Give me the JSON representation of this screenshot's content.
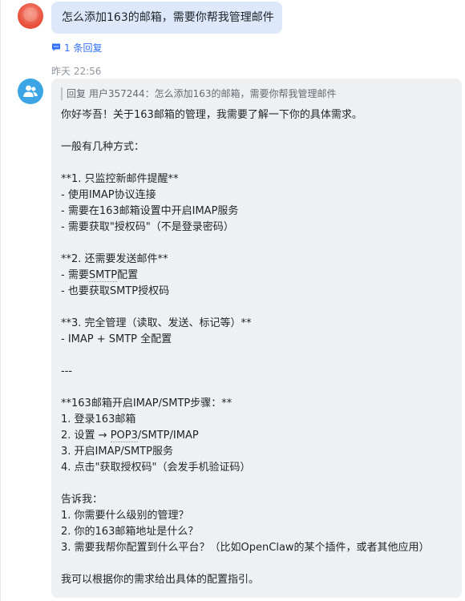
{
  "user_message": {
    "text": "怎么添加163的邮箱，需要你帮我管理邮件"
  },
  "reply_link": {
    "label": "1 条回复"
  },
  "timestamp": "昨天 22:56",
  "bot_message": {
    "quote": "回复 用户357244：怎么添加163的邮箱，需要你帮我管理邮件",
    "lines": [
      "你好岑吾！关于163邮箱的管理，我需要了解一下你的具体需求。",
      "",
      "一般有几种方式：",
      "",
      "**1. 只监控新邮件提醒**",
      "- 使用IMAP协议连接",
      "- 需要在163邮箱设置中开启IMAP服务",
      "- 需要获取\"授权码\"（不是登录密码）",
      "",
      "**2. 还需要发送邮件**",
      "- 需要SMTP配置",
      "- 也要获取SMTP授权码",
      "",
      "**3. 完全管理（读取、发送、标记等）**",
      "- IMAP + SMTP 全配置",
      "",
      "---",
      "",
      "**163邮箱开启IMAP/SMTP步骤：**",
      "1. 登录163邮箱",
      "2. 设置 → POP3/SMTP/IMAP",
      "3. 开启IMAP/SMTP服务",
      "4. 点击\"获取授权码\"（会发手机验证码）",
      "",
      "告诉我：",
      "1. 你需要什么级别的管理？",
      "2. 你的163邮箱地址是什么？",
      "3. 需要我帮你配置到什么平台？（比如OpenClaw的某个插件，或者其他应用）",
      "",
      "我可以根据你的需求给出具体的配置指引。"
    ]
  },
  "icons": {
    "user_avatar": "user-avatar",
    "bot_avatar": "group-users-icon",
    "reply": "comment-icon"
  },
  "colors": {
    "accent": "#3370ff",
    "user_bubble": "#dde8fb",
    "bot_bubble": "#eff0f1",
    "bot_avatar": "#3ba5e5"
  }
}
